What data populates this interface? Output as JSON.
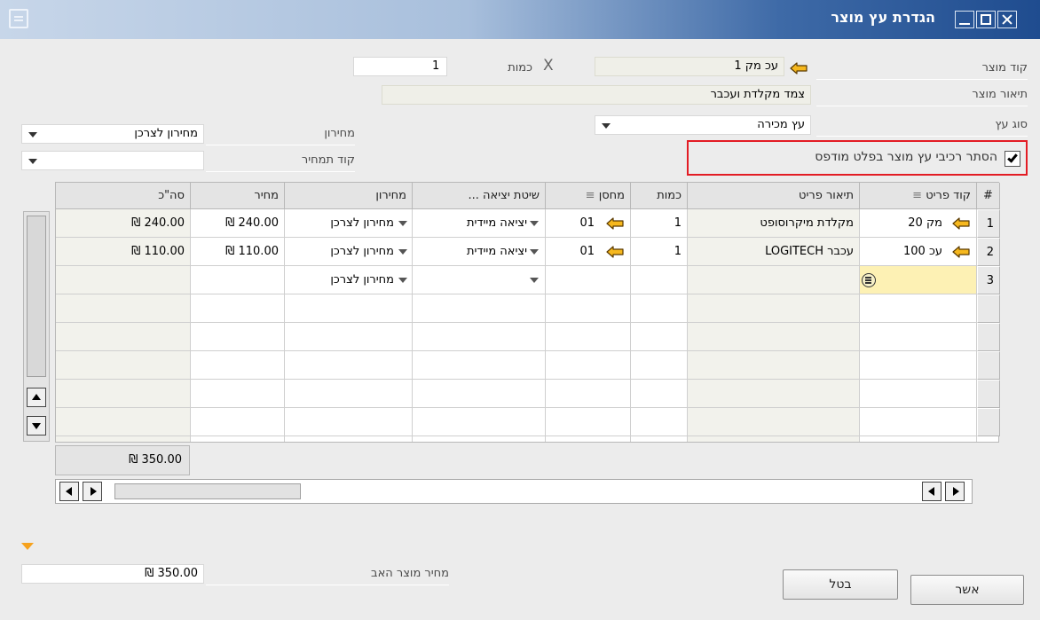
{
  "window": {
    "title": "הגדרת עץ מוצר"
  },
  "header": {
    "product_code_label": "קוד מוצר",
    "product_code_value": "עכ מק 1",
    "quantity_label": "כמות",
    "quantity_value": "1",
    "quantity_x": "X",
    "product_desc_label": "תיאור מוצר",
    "product_desc_value": "צמד מקלדת ועכבר",
    "tree_type_label": "סוג עץ",
    "tree_type_value": "עץ מכירה",
    "price_list_label": "מחירון",
    "price_list_value": "מחירון לצרכן",
    "price_code_label": "קוד תמחיר",
    "price_code_value": "",
    "hide_components_label": "הסתר רכיבי עץ מוצר בפלט מודפס",
    "hide_components_checked": true
  },
  "grid": {
    "columns": [
      "#",
      "קוד פריט",
      "תיאור פריט",
      "כמות",
      "מחסן",
      "שיטת יציאה ...",
      "מחירון",
      "מחיר",
      "סה\"כ"
    ],
    "filter_glyph": "≡",
    "rows": [
      {
        "num": "1",
        "item_code": "מק 20",
        "item_desc": "מקלדת מיקרוסופט",
        "qty": "1",
        "warehouse": "01",
        "issue_method": "יציאה מיידית",
        "price_list": "מחירון לצרכן",
        "price": "₪ 240.00",
        "total": "₪ 240.00"
      },
      {
        "num": "2",
        "item_code": "עכ 100",
        "item_desc": "עכבר LOGITECH",
        "qty": "1",
        "warehouse": "01",
        "issue_method": "יציאה מיידית",
        "price_list": "מחירון לצרכן",
        "price": "₪ 110.00",
        "total": "₪ 110.00"
      },
      {
        "num": "3",
        "item_code": "",
        "item_desc": "",
        "qty": "",
        "warehouse": "",
        "issue_method": "",
        "price_list": "מחירון לצרכן",
        "price": "",
        "total": ""
      }
    ],
    "grand_total": "₪ 350.00"
  },
  "footer": {
    "parent_price_label": "מחיר מוצר האב",
    "parent_price_value": "₪ 350.00",
    "ok_label": "אשר",
    "cancel_label": "בטל"
  },
  "colors": {
    "arrow": "#f6b81e",
    "highlight_border": "#e31c24",
    "selected_cell": "#fdf1b4"
  }
}
